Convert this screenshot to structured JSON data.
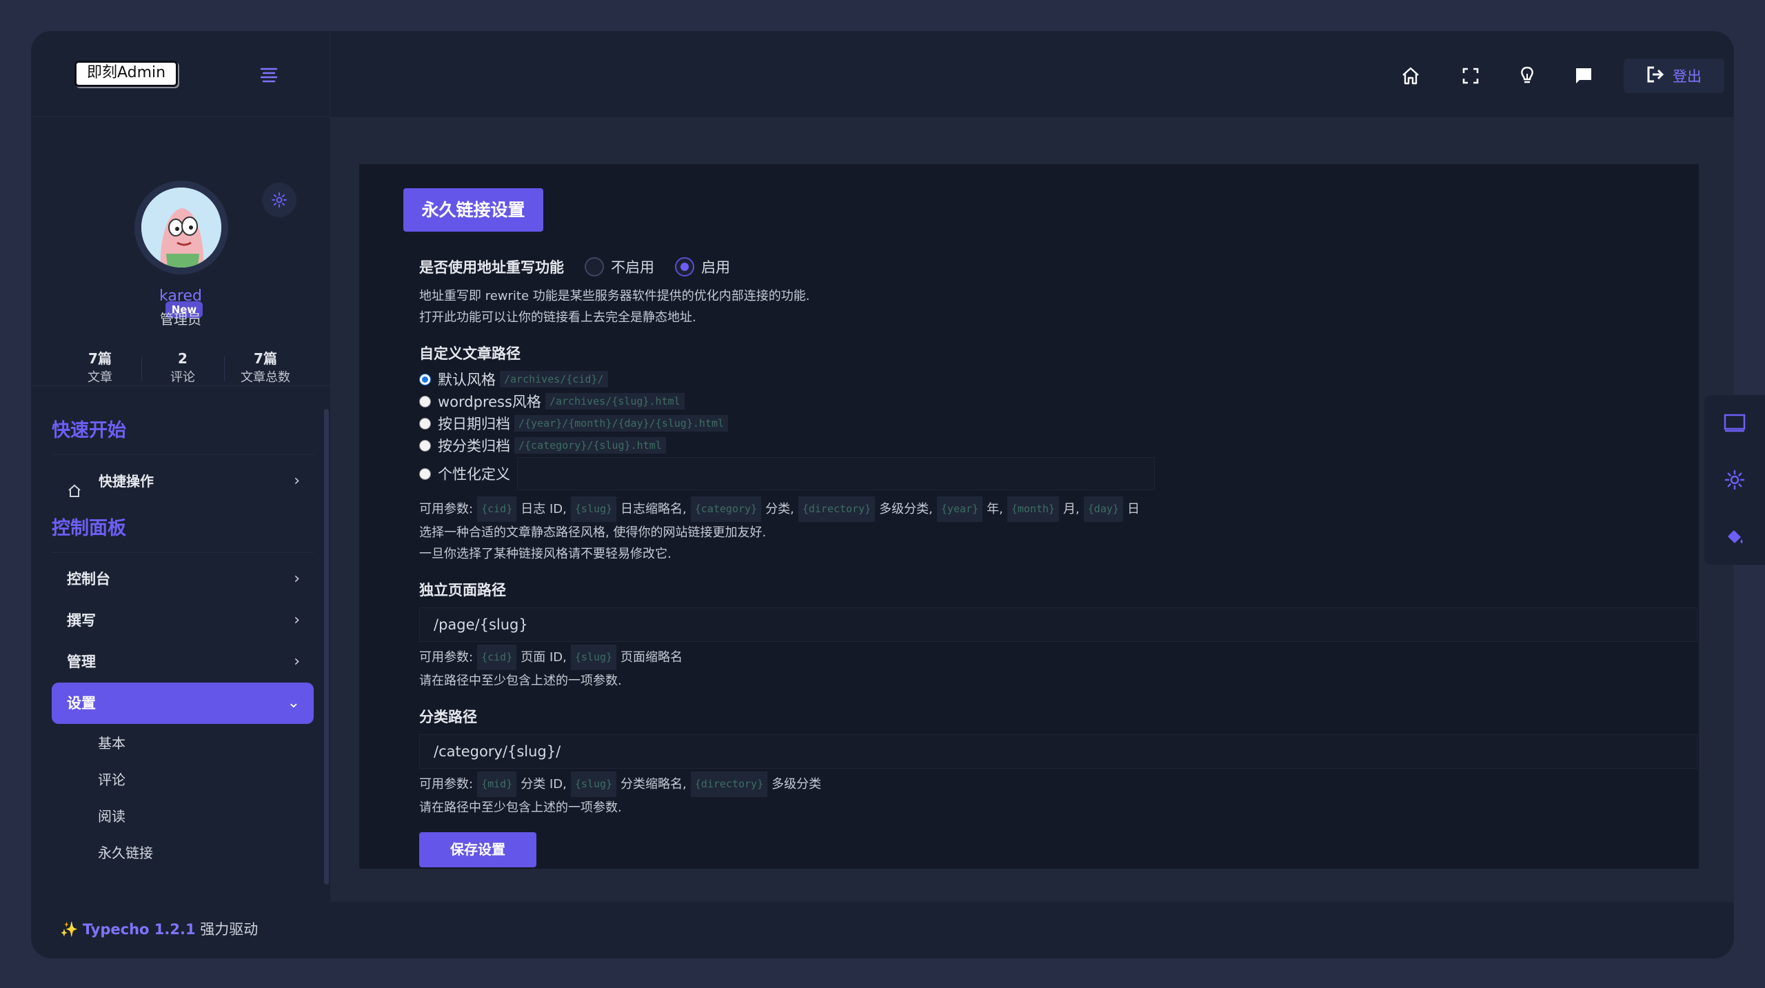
{
  "brand": {
    "logo_text": "即刻Admin"
  },
  "profile": {
    "username": "kared",
    "role": "管理员",
    "badge": "New",
    "stats": [
      {
        "value": "7篇",
        "label": "文章"
      },
      {
        "value": "2",
        "label": "评论"
      },
      {
        "value": "7篇",
        "label": "文章总数"
      }
    ]
  },
  "nav": {
    "section_quick": "快速开始",
    "quick_item": "快捷操作",
    "section_panel": "控制面板",
    "items": [
      {
        "label": "控制台"
      },
      {
        "label": "撰写"
      },
      {
        "label": "管理"
      },
      {
        "label": "设置"
      }
    ],
    "sub_items": [
      {
        "label": "基本"
      },
      {
        "label": "评论"
      },
      {
        "label": "阅读"
      },
      {
        "label": "永久链接"
      }
    ]
  },
  "header": {
    "logout_label": "登出"
  },
  "card": {
    "tab_title": "永久链接设置",
    "rewrite": {
      "label": "是否使用地址重写功能",
      "options": [
        "不启用",
        "启用"
      ],
      "selected": "启用",
      "desc1": "地址重写即 rewrite 功能是某些服务器软件提供的优化内部连接的功能.",
      "desc2": "打开此功能可以让你的链接看上去完全是静态地址."
    },
    "post_path": {
      "label": "自定义文章路径",
      "options": [
        {
          "label": "默认风格",
          "code": "/archives/{cid}/"
        },
        {
          "label": "wordpress风格",
          "code": "/archives/{slug}.html"
        },
        {
          "label": "按日期归档",
          "code": "/{year}/{month}/{day}/{slug}.html"
        },
        {
          "label": "按分类归档",
          "code": "/{category}/{slug}.html"
        }
      ],
      "custom_label": "个性化定义",
      "custom_value": "",
      "params_prefix": "可用参数:",
      "params": [
        {
          "code": "{cid}",
          "desc": "日志 ID,"
        },
        {
          "code": "{slug}",
          "desc": "日志缩略名,"
        },
        {
          "code": "{category}",
          "desc": "分类,"
        },
        {
          "code": "{directory}",
          "desc": "多级分类,"
        },
        {
          "code": "{year}",
          "desc": "年,"
        },
        {
          "code": "{month}",
          "desc": "月,"
        },
        {
          "code": "{day}",
          "desc": "日"
        }
      ],
      "desc1": "选择一种合适的文章静态路径风格, 使得你的网站链接更加友好.",
      "desc2": "一旦你选择了某种链接风格请不要轻易修改它."
    },
    "page_path": {
      "label": "独立页面路径",
      "value": "/page/{slug}",
      "params_prefix": "可用参数:",
      "params": [
        {
          "code": "{cid}",
          "desc": "页面 ID,"
        },
        {
          "code": "{slug}",
          "desc": "页面缩略名"
        }
      ],
      "desc": "请在路径中至少包含上述的一项参数."
    },
    "category_path": {
      "label": "分类路径",
      "value": "/category/{slug}/",
      "params_prefix": "可用参数:",
      "params": [
        {
          "code": "{mid}",
          "desc": "分类 ID,"
        },
        {
          "code": "{slug}",
          "desc": "分类缩略名,"
        },
        {
          "code": "{directory}",
          "desc": "多级分类"
        }
      ],
      "desc": "请在路径中至少包含上述的一项参数."
    },
    "save_label": "保存设置"
  },
  "footer": {
    "brand": "Typecho 1.2.1",
    "suffix": "强力驱动"
  },
  "colors": {
    "accent": "#6456e8",
    "link": "#7f74ff",
    "bg": "#1a2132",
    "main_bg": "#202839",
    "card_bg": "#131927"
  },
  "icons": [
    "menu-icon",
    "home-icon",
    "fullscreen-icon",
    "bulb-icon",
    "message-icon",
    "logout-icon",
    "gear-icon",
    "monitor-icon",
    "paint-bucket-icon",
    "sparkle-icon"
  ]
}
